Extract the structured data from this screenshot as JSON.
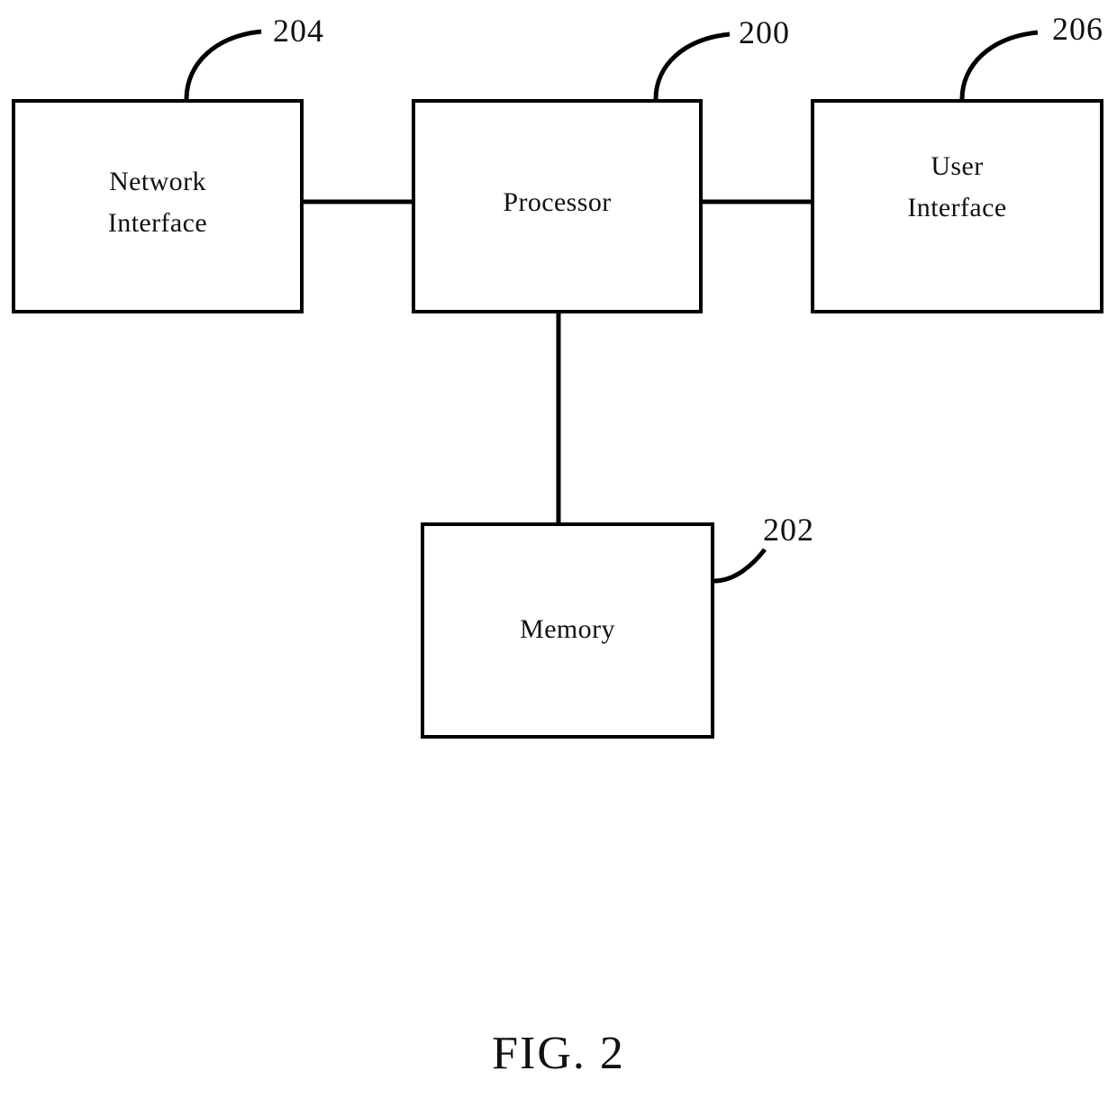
{
  "figure": {
    "caption": "FIG. 2",
    "type": "patent-block-diagram",
    "line_color": "#000000",
    "text_color": "#111111",
    "background_color": "#ffffff"
  },
  "blocks": [
    {
      "id": "network-interface",
      "label": "Network\nInterface",
      "reference_numeral": "204"
    },
    {
      "id": "processor",
      "label": "Processor",
      "reference_numeral": "200"
    },
    {
      "id": "user-interface",
      "label": "User\nInterface",
      "reference_numeral": "206"
    },
    {
      "id": "memory",
      "label": "Memory",
      "reference_numeral": "202"
    }
  ],
  "reference_numerals": {
    "network_interface": "204",
    "processor": "200",
    "user_interface": "206",
    "memory": "202"
  },
  "connections": [
    {
      "from": "network-interface",
      "to": "processor",
      "orientation": "horizontal"
    },
    {
      "from": "processor",
      "to": "user-interface",
      "orientation": "horizontal"
    },
    {
      "from": "processor",
      "to": "memory",
      "orientation": "vertical"
    }
  ]
}
